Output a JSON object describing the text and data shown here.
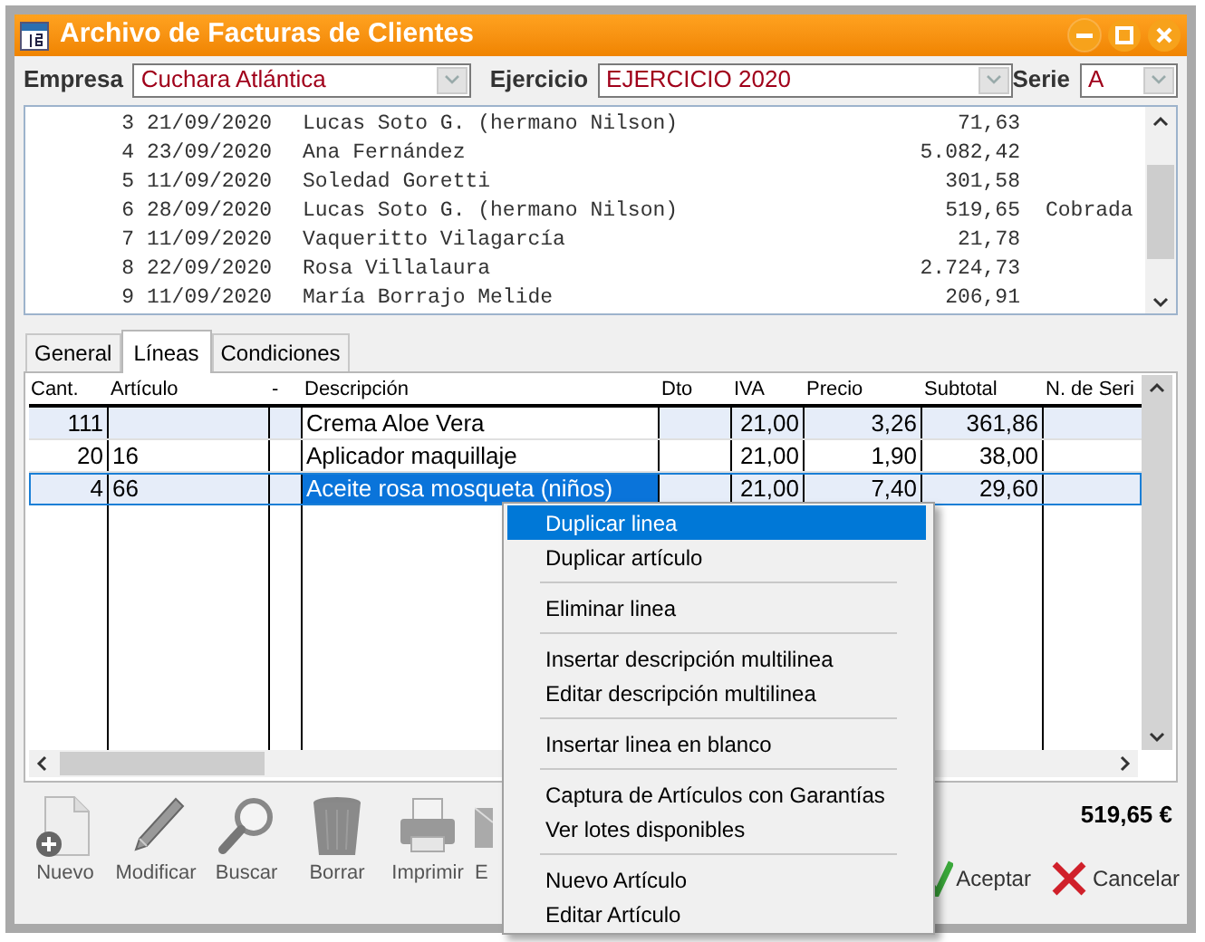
{
  "window": {
    "title": "Archivo de Facturas de Clientes"
  },
  "filters": [
    {
      "label": "Empresa",
      "value": "Cuchara Atlántica"
    },
    {
      "label": "Ejercicio",
      "value": "EJERCICIO 2020"
    },
    {
      "label": "Serie",
      "value": "A"
    }
  ],
  "invoices": [
    {
      "number": "3",
      "date": "21/09/2020",
      "client": "Lucas Soto G. (hermano Nilson)",
      "amount": "71,63"
    },
    {
      "number": "4",
      "date": "23/09/2020",
      "client": "Ana Fernández",
      "amount": "5.082,42"
    },
    {
      "number": "5",
      "date": "11/09/2020",
      "client": "Soledad Goretti",
      "amount": "301,58"
    },
    {
      "number": "6",
      "date": "28/09/2020",
      "client": "Lucas Soto G. (hermano Nilson)",
      "amount": "519,65",
      "status": "Cobrada"
    },
    {
      "number": "7",
      "date": "11/09/2020",
      "client": "Vaqueritto Vilagarcía",
      "amount": "21,78"
    },
    {
      "number": "8",
      "date": "22/09/2020",
      "client": "Rosa Villalaura",
      "amount": "2.724,73"
    },
    {
      "number": "9",
      "date": "11/09/2020",
      "client": "María Borrajo Melide",
      "amount": "206,91"
    }
  ],
  "tabs": [
    {
      "label": "General",
      "selected": false
    },
    {
      "label": "Líneas",
      "selected": true
    },
    {
      "label": "Condiciones",
      "selected": false
    }
  ],
  "lines_table": {
    "columns": [
      "Cant.",
      "Artículo",
      "-",
      "Descripción",
      "Dto",
      "IVA",
      "Precio",
      "Subtotal",
      "N. de Seri"
    ],
    "rows": [
      {
        "cells": [
          "111",
          "",
          "",
          "Crema Aloe Vera",
          "",
          "21,00",
          "3,26",
          "361,86",
          ""
        ],
        "shaded": true,
        "selected": false
      },
      {
        "cells": [
          "20",
          "16",
          "",
          "Aplicador maquillaje",
          "",
          "21,00",
          "1,90",
          "38,00",
          ""
        ],
        "shaded": false,
        "selected": false
      },
      {
        "cells": [
          "4",
          "66",
          "",
          "Aceite rosa mosqueta (niños)",
          "",
          "21,00",
          "7,40",
          "29,60",
          ""
        ],
        "shaded": true,
        "selected": true
      }
    ]
  },
  "toolbar": [
    {
      "label": "Nuevo",
      "kind": "new"
    },
    {
      "label": "Modificar",
      "kind": "pen"
    },
    {
      "label": "Buscar",
      "kind": "search"
    },
    {
      "label": "Borrar",
      "kind": "bin"
    },
    {
      "label": "Imprimir",
      "kind": "printer"
    },
    {
      "label": "E",
      "kind": "mail"
    }
  ],
  "total": "519,65 €",
  "actions": [
    {
      "label": "Aceptar",
      "kind": "accept"
    },
    {
      "label": "Cancelar",
      "kind": "cancel"
    }
  ],
  "context_menu": [
    {
      "kind": "item",
      "label": "Duplicar linea",
      "selected": true
    },
    {
      "kind": "item",
      "label": "Duplicar artículo",
      "selected": false
    },
    {
      "kind": "separator"
    },
    {
      "kind": "item",
      "label": "Eliminar linea",
      "selected": false
    },
    {
      "kind": "separator"
    },
    {
      "kind": "item",
      "label": "Insertar descripción multilinea",
      "selected": false
    },
    {
      "kind": "item",
      "label": "Editar descripción multilinea",
      "selected": false
    },
    {
      "kind": "separator"
    },
    {
      "kind": "item",
      "label": "Insertar linea en blanco",
      "selected": false
    },
    {
      "kind": "separator"
    },
    {
      "kind": "item",
      "label": "Captura de Artículos con Garantías",
      "selected": false
    },
    {
      "kind": "item",
      "label": "Ver lotes disponibles",
      "selected": false
    },
    {
      "kind": "separator"
    },
    {
      "kind": "item",
      "label": "Nuevo Artículo",
      "selected": false
    },
    {
      "kind": "item",
      "label": "Editar Artículo",
      "selected": false
    }
  ]
}
